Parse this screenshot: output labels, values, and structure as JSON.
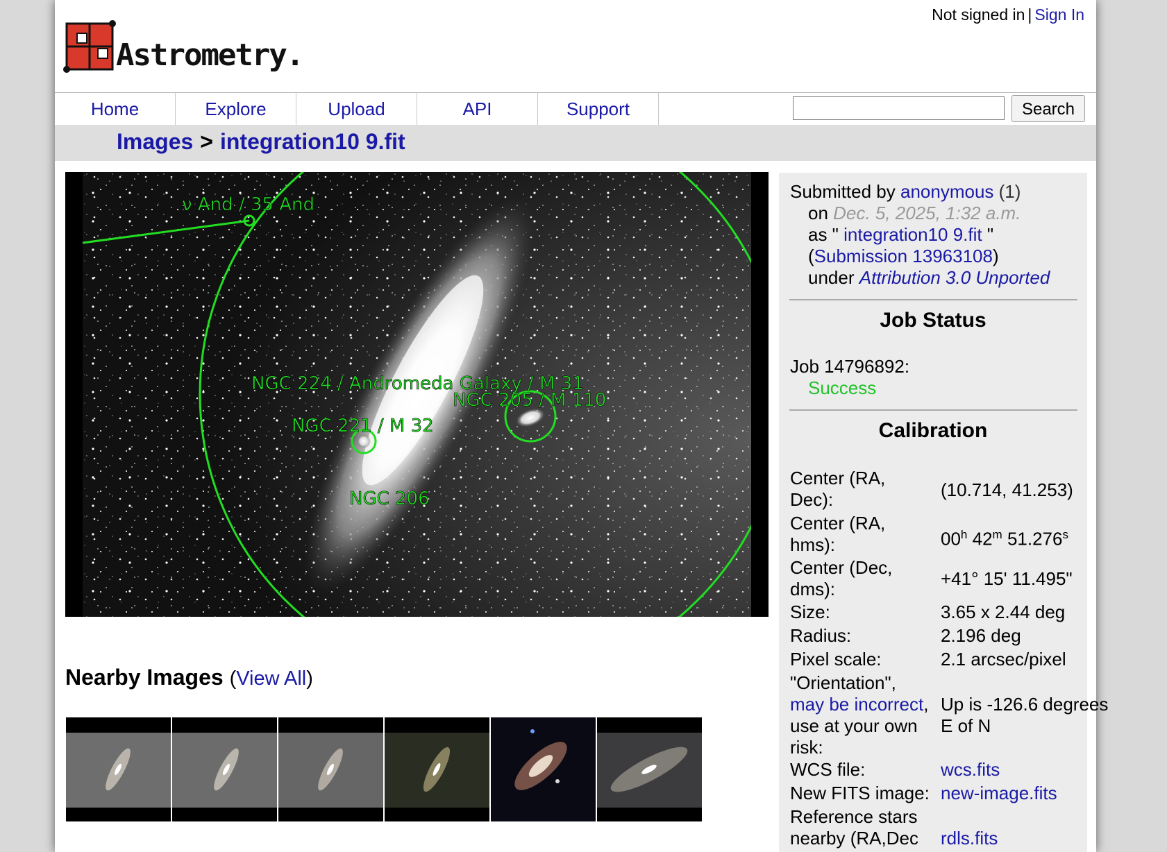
{
  "header": {
    "signin_status": "Not signed in",
    "separator": "|",
    "signin_link": "Sign In"
  },
  "nav": {
    "items": [
      "Home",
      "Explore",
      "Upload",
      "API",
      "Support"
    ],
    "search_button": "Search",
    "search_value": ""
  },
  "breadcrumb": {
    "parent": "Images",
    "separator": ">",
    "current": "integration10 9.fit"
  },
  "annotations": [
    "ν And / 35 And",
    "NGC 224 / Andromeda Galaxy / M 31",
    "NGC 205 / M 110",
    "NGC 221 / M 32",
    "NGC 206"
  ],
  "submission": {
    "submitted_by_label": "Submitted by",
    "user": "anonymous",
    "user_count": "(1)",
    "on_label": "on",
    "date": "Dec. 5, 2025, 1:32 a.m.",
    "as_label": "as \"",
    "filename": "integration10 9.fit",
    "as_close": "\"",
    "submission_open": "(",
    "submission_link": "Submission 13963108",
    "submission_close": ")",
    "under_label": "under",
    "license": "Attribution 3.0 Unported"
  },
  "job_status": {
    "title": "Job Status",
    "job_label": "Job 14796892:",
    "status": "Success"
  },
  "calibration": {
    "title": "Calibration",
    "rows": [
      {
        "label_1": "Center (RA,",
        "label_2": "Dec):",
        "value": "(10.714, 41.253)"
      },
      {
        "label_1": "Center (RA,",
        "label_2": "hms):",
        "ra_h": "00",
        "h": "h",
        "ra_m": "42",
        "m": "m",
        "ra_s": "51.276",
        "s": "s"
      },
      {
        "label_1": "Center (Dec,",
        "label_2": "dms):",
        "value": "+41° 15' 11.495\""
      },
      {
        "label": "Size:",
        "value": "3.65 x 2.44 deg"
      },
      {
        "label": "Radius:",
        "value": "2.196 deg"
      },
      {
        "label": "Pixel scale:",
        "value": "2.1 arcsec/pixel"
      },
      {
        "label_1": "\"Orientation\",",
        "label_link": "may be incorrect",
        "label_2": ",",
        "label_3": "use at your own",
        "label_4": "risk:",
        "value_1": "Up is -126.6 degrees",
        "value_2": "E of N"
      },
      {
        "label": "WCS file:",
        "value_link": "wcs.fits"
      },
      {
        "label": "New FITS image:",
        "value_link": "new-image.fits"
      },
      {
        "label_1": "Reference stars",
        "label_2": "nearby (RA,Dec",
        "value_link": "rdls.fits"
      }
    ]
  },
  "nearby": {
    "heading": "Nearby Images",
    "open_paren": "(",
    "view_all": "View All",
    "close_paren": ")"
  },
  "colors": {
    "link": "#1a1aa6",
    "success": "#22c22a",
    "annotation_green": "#22dd22",
    "logo_red": "#d9392b"
  }
}
